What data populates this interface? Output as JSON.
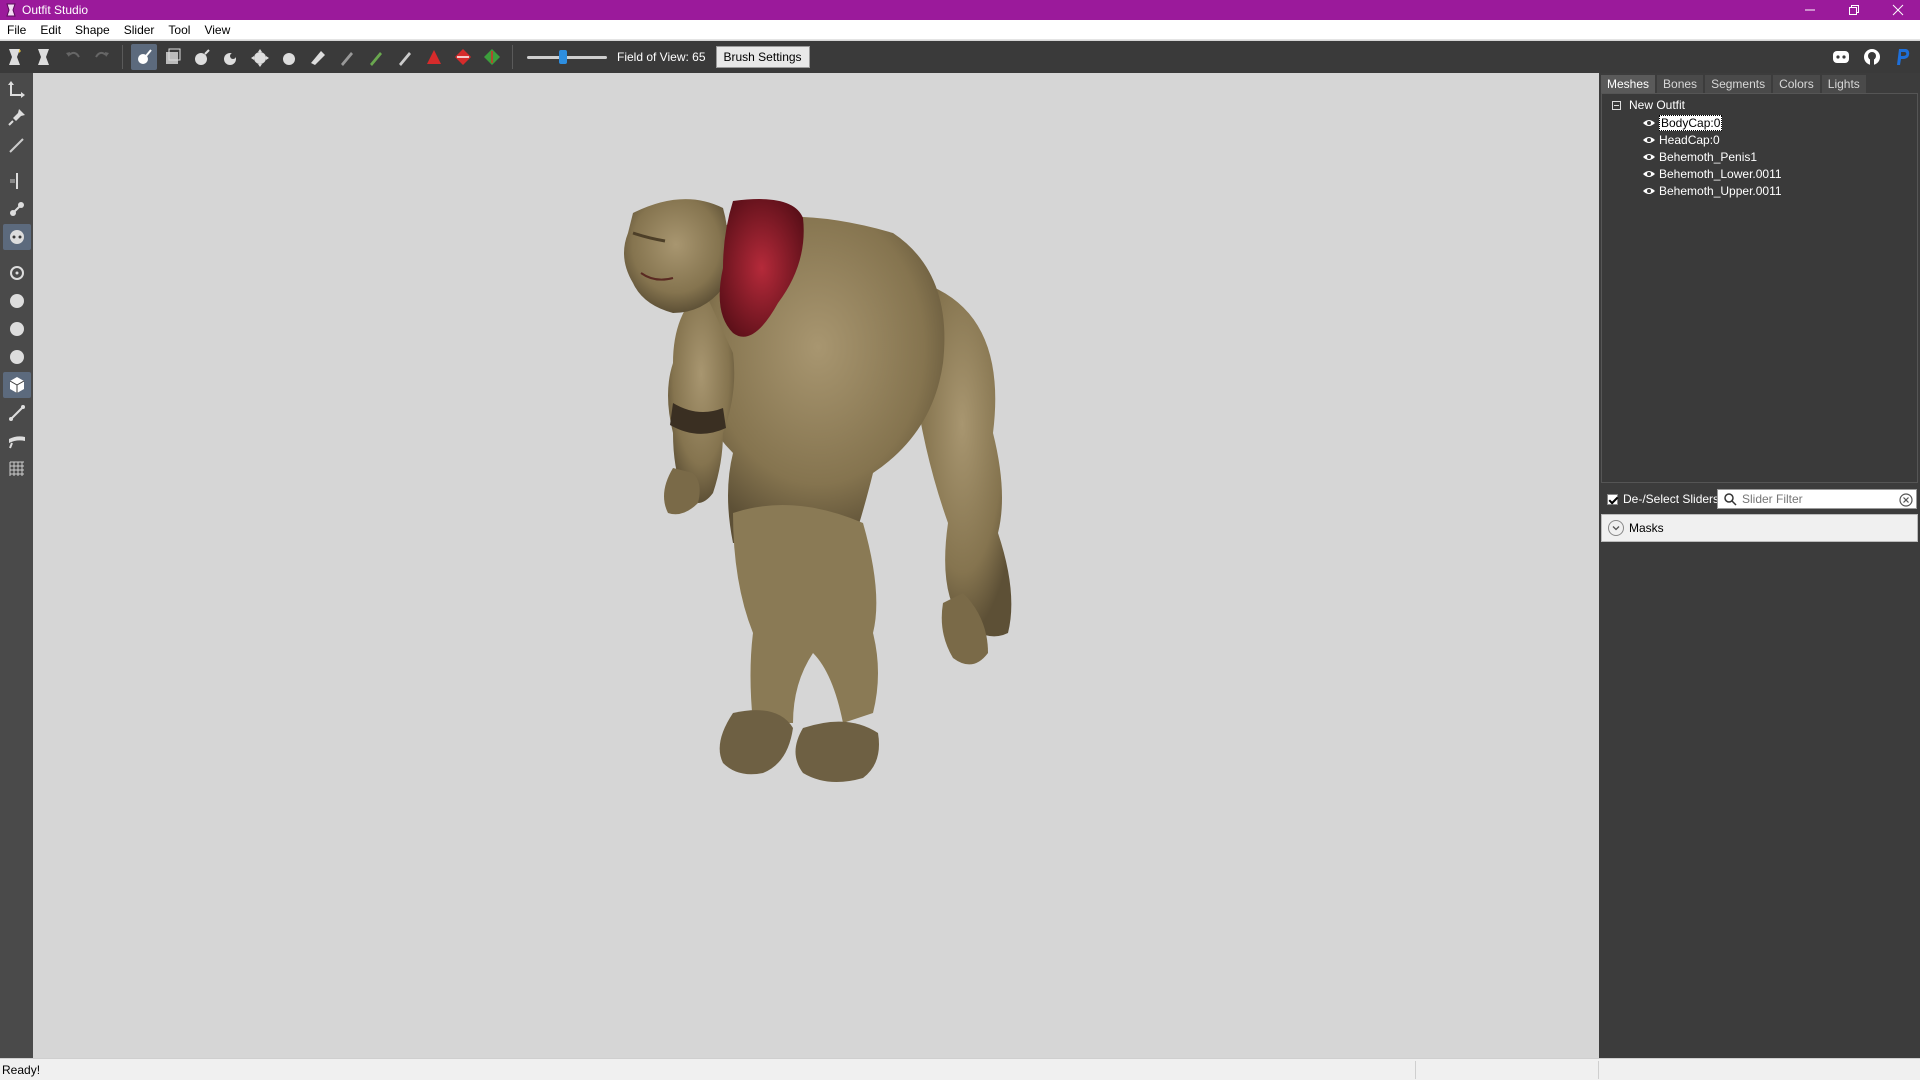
{
  "window": {
    "title": "Outfit Studio",
    "minimize_icon": "minimize-icon",
    "maximize_icon": "restore-icon",
    "close_icon": "close-icon",
    "accent_color": "#9b1a9b"
  },
  "menu": {
    "items": [
      "File",
      "Edit",
      "Shape",
      "Slider",
      "Tool",
      "View"
    ]
  },
  "toolbar": {
    "buttons": [
      "load-reference-icon",
      "load-outfit-icon",
      "undo-icon",
      "redo-icon",
      "select-brush-icon",
      "mask-brush-icon",
      "inflate-brush-icon",
      "deflate-brush-icon",
      "move-brush-icon",
      "smooth-brush-icon",
      "undiff-brush-icon",
      "weight-brush-icon",
      "color-brush-icon",
      "alpha-brush-icon",
      "collapse-vertex-icon",
      "flip-edge-icon",
      "split-edge-icon"
    ],
    "fov_value": 0.45,
    "fov_label": "Field of View: 65",
    "brush_settings_label": "Brush Settings",
    "right_icons": [
      "discord-icon",
      "github-icon",
      "paypal-icon"
    ]
  },
  "leftbar": {
    "tools": [
      "transform-tool-icon",
      "pivot-tool-icon",
      "vertex-select-icon",
      "mirror-icon",
      "connected-only-icon",
      "xray-icon",
      "point-size-icon",
      "sphere-small-icon",
      "sphere-medium-icon",
      "sphere-large-icon",
      "cube-icon",
      "bone-icon",
      "weld-icon",
      "grid-icon"
    ]
  },
  "right_panel": {
    "tabs": [
      "Meshes",
      "Bones",
      "Segments",
      "Colors",
      "Lights"
    ],
    "active_tab": "Meshes",
    "tree": {
      "root": "New Outfit",
      "items": [
        "BodyCap:0",
        "HeadCap:0",
        "Behemoth_Penis1",
        "Behemoth_Lower.0011",
        "Behemoth_Upper.0011"
      ],
      "selected": "BodyCap:0"
    },
    "deselect_label": "De-/Select Sliders",
    "filter_placeholder": "Slider Filter",
    "masks_label": "Masks"
  },
  "status": {
    "text": "Ready!"
  }
}
